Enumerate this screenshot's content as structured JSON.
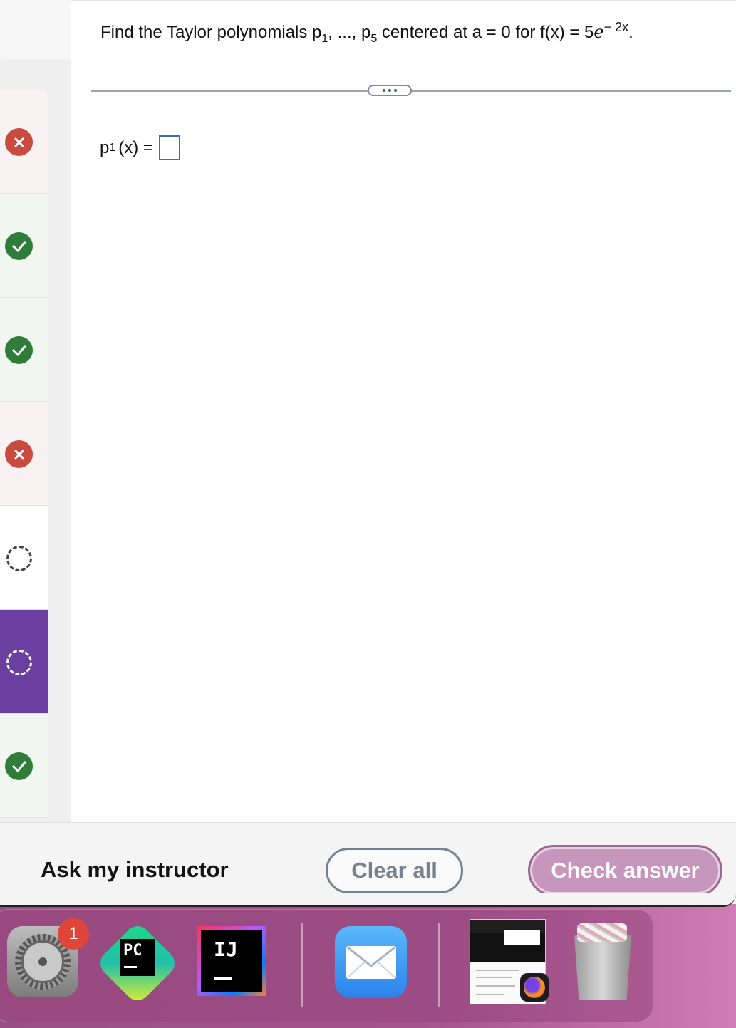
{
  "question": {
    "lead": "Find the Taylor polynomials p",
    "sub_first": "1",
    "mid": ", ..., p",
    "sub_last": "5",
    "tail": " centered at a = 0 for f(x) = 5",
    "e_symbol": "e",
    "exponent": "− 2x",
    "end": "."
  },
  "answer": {
    "label_p": "p",
    "label_sub": "1",
    "label_rest": "(x) ="
  },
  "sidebar": {
    "items": [
      {
        "status": "incorrect",
        "icon": "x-circle-icon"
      },
      {
        "status": "correct",
        "icon": "check-circle-icon"
      },
      {
        "status": "correct",
        "icon": "check-circle-icon"
      },
      {
        "status": "incorrect",
        "icon": "x-circle-icon"
      },
      {
        "status": "unanswered",
        "icon": "dashed-circle-icon"
      },
      {
        "status": "current",
        "icon": "dashed-circle-icon"
      },
      {
        "status": "correct",
        "icon": "check-circle-icon"
      }
    ]
  },
  "bottom_bar": {
    "ask_instructor": "Ask my instructor",
    "clear_all": "Clear all",
    "check_answer": "Check answer"
  },
  "dock": {
    "settings_badge": "1",
    "pycharm_label": "PC",
    "intellij_label": "IJ"
  },
  "colors": {
    "incorrect": "#c94a3f",
    "correct": "#2f7d38",
    "current": "#6b3fa0",
    "check_answer": "#c796bd",
    "input_border": "#3e6cc0"
  }
}
